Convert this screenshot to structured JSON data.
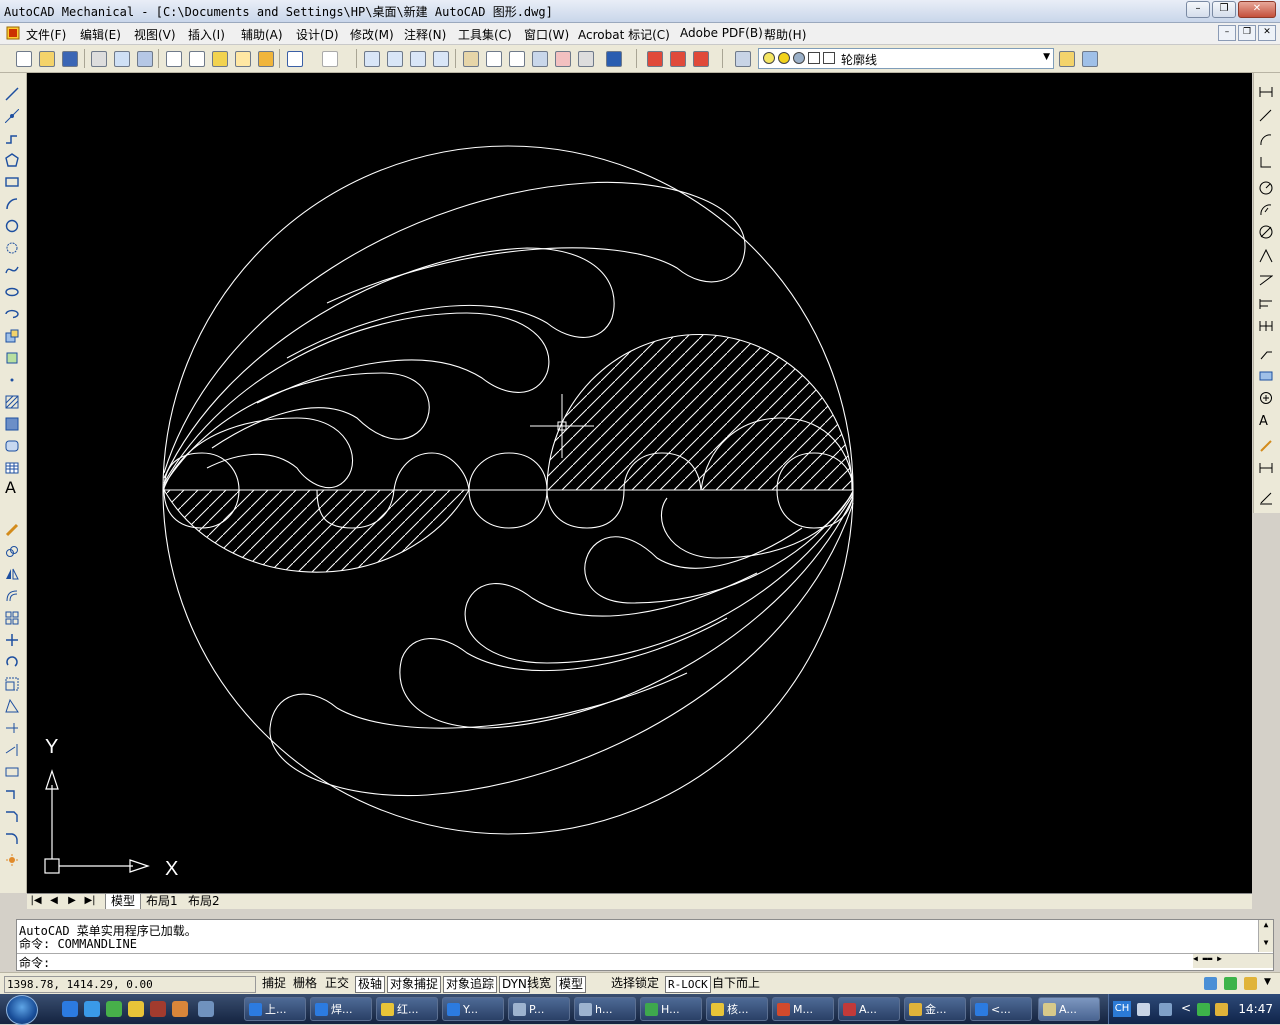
{
  "window": {
    "title": "AutoCAD Mechanical - [C:\\Documents and Settings\\HP\\桌面\\新建 AutoCAD 图形.dwg]",
    "controls": [
      "minimize",
      "restore",
      "close"
    ]
  },
  "menu": {
    "items": [
      "文件(F)",
      "编辑(E)",
      "视图(V)",
      "插入(I)",
      "辅助(A)",
      "设计(D)",
      "修改(M)",
      "注释(N)",
      "工具集(C)",
      "窗口(W)",
      "Acrobat 标记(C)",
      "Adobe PDF(B)",
      "帮助(H)"
    ]
  },
  "layer": {
    "current": "轮廓线",
    "swatch_colors": [
      "#f5e663",
      "#f2d21b",
      "#9bb0c8",
      "#ffffff"
    ]
  },
  "canvas": {
    "background": "#000000",
    "line_color": "#ffffff",
    "ucs_x_label": "X",
    "ucs_y_label": "Y"
  },
  "layout_tabs": {
    "items": [
      "模型",
      "布局1",
      "布局2"
    ],
    "active": "模型"
  },
  "command": {
    "history": [
      "AutoCAD 菜单实用程序已加载。",
      "命令: COMMANDLINE"
    ],
    "prompt": "命令:"
  },
  "status": {
    "coordinates": "1398.78, 1414.29, 0.00",
    "toggles": [
      "捕捉",
      "栅格",
      "正交",
      "极轴",
      "对象捕捉",
      "对象追踪",
      "DYN",
      "线宽",
      "模型"
    ],
    "pressed": [
      "极轴",
      "对象捕捉",
      "对象追踪",
      "DYN",
      "模型"
    ],
    "extras": [
      "选择锁定",
      "R-LOCK",
      "自下而上"
    ]
  },
  "taskbar": {
    "tasks": [
      "上...",
      "焊...",
      "红...",
      "Y...",
      "P...",
      "h...",
      "H...",
      "核...",
      "M...",
      "A...",
      "金...",
      "<...",
      "A..."
    ],
    "active_task": "A...",
    "language": "CH",
    "time": "14:47"
  }
}
